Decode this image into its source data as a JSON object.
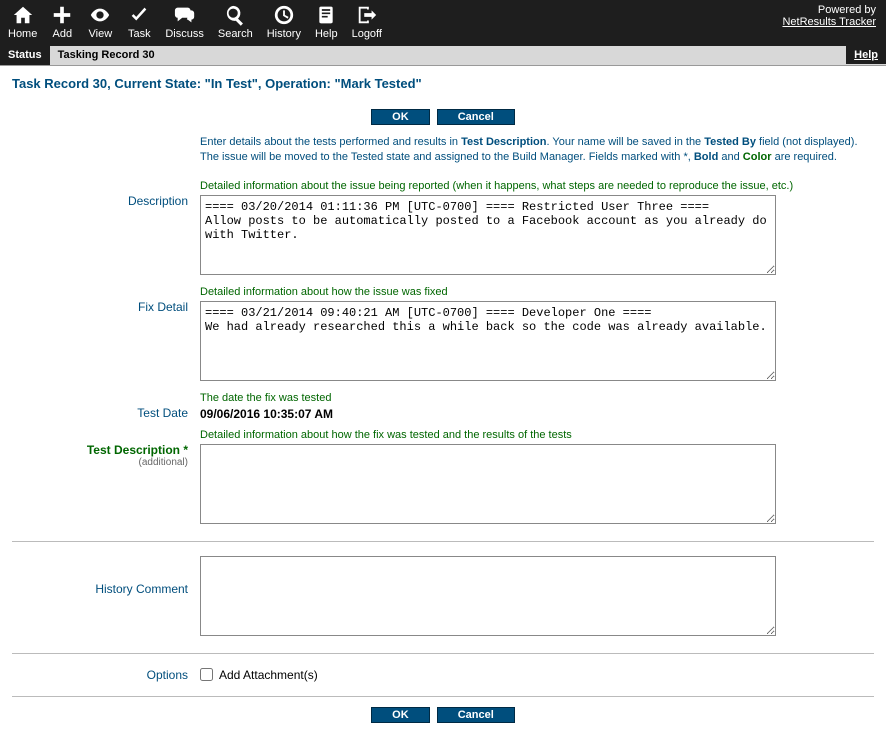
{
  "toolbar": {
    "items": [
      {
        "label": "Home"
      },
      {
        "label": "Add"
      },
      {
        "label": "View"
      },
      {
        "label": "Task"
      },
      {
        "label": "Discuss"
      },
      {
        "label": "Search"
      },
      {
        "label": "History"
      },
      {
        "label": "Help"
      },
      {
        "label": "Logoff"
      }
    ],
    "powered_prefix": "Powered by",
    "powered_link": "NetResults Tracker"
  },
  "subbar": {
    "status": "Status",
    "tasking": "Tasking Record 30",
    "help": "Help"
  },
  "page_title": "Task Record 30, Current State: \"In Test\", Operation: \"Mark Tested\"",
  "buttons": {
    "ok": "OK",
    "cancel": "Cancel"
  },
  "intro": {
    "p1a": "Enter details about the tests performed and results in ",
    "p1b": "Test Description",
    "p1c": ". Your name will be saved in the ",
    "p1d": "Tested By",
    "p1e": " field (not displayed). The issue will be moved to the Tested state and assigned to the Build Manager. Fields marked with *, ",
    "p1f": "Bold",
    "p1g": " and ",
    "p1h": "Color",
    "p1i": " are required."
  },
  "fields": {
    "description": {
      "label": "Description",
      "hint": "Detailed information about the issue being reported (when it happens, what steps are needed to reproduce the issue, etc.)",
      "value": "==== 03/20/2014 01:11:36 PM [UTC-0700] ==== Restricted User Three ====\nAllow posts to be automatically posted to a Facebook account as you already do with Twitter."
    },
    "fix_detail": {
      "label": "Fix Detail",
      "hint": "Detailed information about how the issue was fixed",
      "value": "==== 03/21/2014 09:40:21 AM [UTC-0700] ==== Developer One ====\nWe had already researched this a while back so the code was already available."
    },
    "test_date": {
      "label": "Test Date",
      "hint": "The date the fix was tested",
      "value": "09/06/2016 10:35:07 AM"
    },
    "test_description": {
      "label": "Test Description *",
      "sublabel": "(additional)",
      "hint": "Detailed information about how the fix was tested and the results of the tests",
      "value": ""
    },
    "history_comment": {
      "label": "History Comment",
      "value": ""
    },
    "options": {
      "label": "Options",
      "add_attachments": "Add Attachment(s)"
    }
  }
}
